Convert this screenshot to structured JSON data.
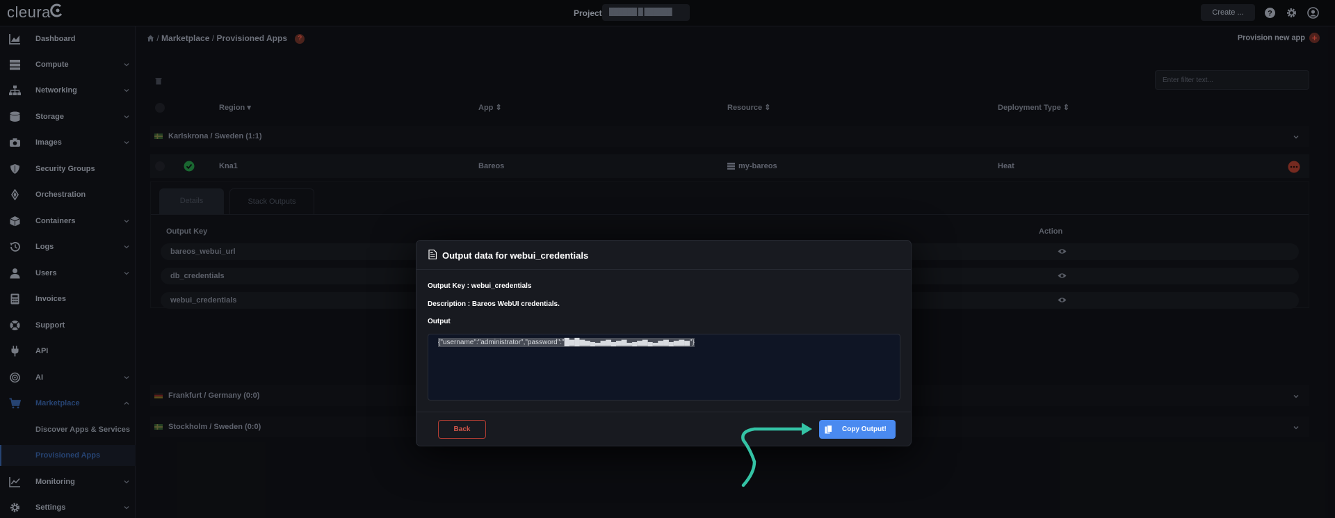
{
  "topbar": {
    "logo": "cleura",
    "project_label": "Project",
    "project_value": "██████ █ ██████",
    "create_label": "Create ...",
    "icons": [
      "help-icon",
      "gear-icon",
      "user-icon"
    ]
  },
  "sidebar": {
    "items": [
      {
        "label": "Dashboard",
        "icon": "chart-icon",
        "expandable": false
      },
      {
        "label": "Compute",
        "icon": "server-icon",
        "expandable": true
      },
      {
        "label": "Networking",
        "icon": "network-icon",
        "expandable": true
      },
      {
        "label": "Storage",
        "icon": "database-icon",
        "expandable": true
      },
      {
        "label": "Images",
        "icon": "camera-icon",
        "expandable": true
      },
      {
        "label": "Security Groups",
        "icon": "shield-icon",
        "expandable": false
      },
      {
        "label": "Orchestration",
        "icon": "orchestration-icon",
        "expandable": false
      },
      {
        "label": "Containers",
        "icon": "box-icon",
        "expandable": true
      },
      {
        "label": "Logs",
        "icon": "history-icon",
        "expandable": true
      },
      {
        "label": "Users",
        "icon": "user-icon",
        "expandable": true
      },
      {
        "label": "Invoices",
        "icon": "calculator-icon",
        "expandable": false
      },
      {
        "label": "Support",
        "icon": "lifebuoy-icon",
        "expandable": false
      },
      {
        "label": "API",
        "icon": "plug-icon",
        "expandable": false
      },
      {
        "label": "AI",
        "icon": "brain-icon",
        "expandable": true
      },
      {
        "label": "Marketplace",
        "icon": "cart-icon",
        "expandable": true
      },
      {
        "label": "Discover Apps & Services",
        "sub": true
      },
      {
        "label": "Provisioned Apps",
        "sub": true
      },
      {
        "label": "Monitoring",
        "icon": "monitor-chart-icon",
        "expandable": true
      },
      {
        "label": "Settings",
        "icon": "gear-icon",
        "expandable": true
      }
    ]
  },
  "breadcrumb": {
    "sep": "/",
    "items": [
      "Marketplace",
      "Provisioned Apps"
    ],
    "help": "?"
  },
  "provision_label": "Provision new app",
  "filter_placeholder": "Enter filter text...",
  "table": {
    "columns": [
      "Region",
      "App",
      "Resource",
      "Deployment Type"
    ],
    "groups": [
      {
        "label": "Karlskrona / Sweden",
        "count": "(1:1)"
      },
      {
        "label": "Frankfurt / Germany",
        "count": "(0:0)"
      },
      {
        "label": "Stockholm / Sweden",
        "count": "(0:0)"
      }
    ],
    "row": {
      "region": "Kna1",
      "app": "Bareos",
      "resource": "my-bareos",
      "deployment": "Heat"
    }
  },
  "detail": {
    "tabs": [
      "Details",
      "Stack Outputs"
    ],
    "output_key_header": "Output Key",
    "action_header": "Action",
    "outputs": [
      "bareos_webui_url",
      "db_credentials",
      "webui_credentials"
    ]
  },
  "modal": {
    "title": "Output data for webui_credentials",
    "output_key_line": "Output Key : webui_credentials",
    "description_line": "Description : Bareos WebUI credentials.",
    "output_label": "Output",
    "output_value": "{\"username\":\"administrator\",\"password\":\"█▆█▆▅▄▃▅▆▄▅▆▃▄▅▆▄▃▅▆▄▅▆▅\"}",
    "back_label": "Back",
    "copy_label": "Copy Output!"
  },
  "colors": {
    "accent": "#4a8af0",
    "danger": "#d2564a",
    "success": "#2fa84f",
    "arrow": "#34c3a5"
  }
}
